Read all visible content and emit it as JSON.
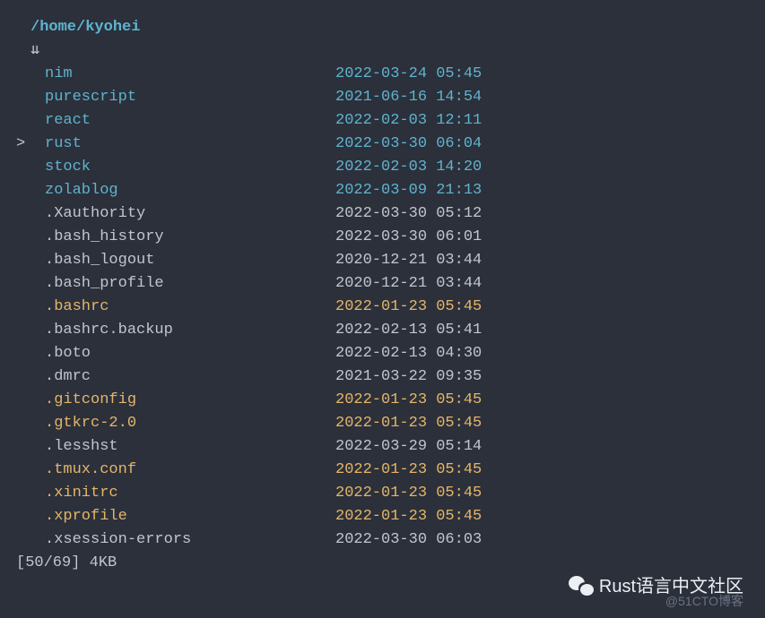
{
  "path": "/home/kyohei",
  "scroll_indicator": "⇊",
  "cursor": ">",
  "entries": [
    {
      "name": "nim",
      "date": "2022-03-24 05:45",
      "kind": "dir",
      "selected": false
    },
    {
      "name": "purescript",
      "date": "2021-06-16 14:54",
      "kind": "dir",
      "selected": false
    },
    {
      "name": "react",
      "date": "2022-02-03 12:11",
      "kind": "dir",
      "selected": false
    },
    {
      "name": "rust",
      "date": "2022-03-30 06:04",
      "kind": "dir",
      "selected": true
    },
    {
      "name": "stock",
      "date": "2022-02-03 14:20",
      "kind": "dir",
      "selected": false
    },
    {
      "name": "zolablog",
      "date": "2022-03-09 21:13",
      "kind": "dir",
      "selected": false
    },
    {
      "name": ".Xauthority",
      "date": "2022-03-30 05:12",
      "kind": "file",
      "selected": false
    },
    {
      "name": ".bash_history",
      "date": "2022-03-30 06:01",
      "kind": "file",
      "selected": false
    },
    {
      "name": ".bash_logout",
      "date": "2020-12-21 03:44",
      "kind": "file",
      "selected": false
    },
    {
      "name": ".bash_profile",
      "date": "2020-12-21 03:44",
      "kind": "file",
      "selected": false
    },
    {
      "name": ".bashrc",
      "date": "2022-01-23 05:45",
      "kind": "highlight",
      "selected": false
    },
    {
      "name": ".bashrc.backup",
      "date": "2022-02-13 05:41",
      "kind": "file",
      "selected": false
    },
    {
      "name": ".boto",
      "date": "2022-02-13 04:30",
      "kind": "file",
      "selected": false
    },
    {
      "name": ".dmrc",
      "date": "2021-03-22 09:35",
      "kind": "file",
      "selected": false
    },
    {
      "name": ".gitconfig",
      "date": "2022-01-23 05:45",
      "kind": "highlight",
      "selected": false
    },
    {
      "name": ".gtkrc-2.0",
      "date": "2022-01-23 05:45",
      "kind": "highlight",
      "selected": false
    },
    {
      "name": ".lesshst",
      "date": "2022-03-29 05:14",
      "kind": "file",
      "selected": false
    },
    {
      "name": ".tmux.conf",
      "date": "2022-01-23 05:45",
      "kind": "highlight",
      "selected": false
    },
    {
      "name": ".xinitrc",
      "date": "2022-01-23 05:45",
      "kind": "highlight",
      "selected": false
    },
    {
      "name": ".xprofile",
      "date": "2022-01-23 05:45",
      "kind": "highlight",
      "selected": false
    },
    {
      "name": ".xsession-errors",
      "date": "2022-03-30 06:03",
      "kind": "file",
      "selected": false
    }
  ],
  "status": "[50/69] 4KB",
  "watermark": "Rust语言中文社区",
  "sub_watermark": "@51CTO博客"
}
